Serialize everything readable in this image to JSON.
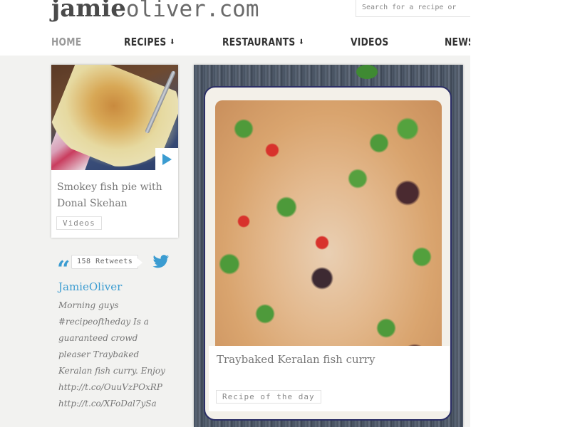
{
  "site": {
    "logo_bold": "jamie",
    "logo_light": "oliver.com"
  },
  "search": {
    "placeholder": "Search for a recipe or"
  },
  "nav": {
    "items": [
      {
        "label": "HOME",
        "has_dropdown": false,
        "active": true
      },
      {
        "label": "RECIPES",
        "has_dropdown": true,
        "active": false
      },
      {
        "label": "RESTAURANTS",
        "has_dropdown": true,
        "active": false
      },
      {
        "label": "VIDEOS",
        "has_dropdown": false,
        "active": false
      },
      {
        "label": "NEWS",
        "has_dropdown": false,
        "active": false
      }
    ],
    "dropdown_glyph": "⬇"
  },
  "video_card": {
    "image_alt": "Smokey fish pie in a blue baking dish",
    "play_icon": "play-icon",
    "title": "Smokey fish pie with Donal Skehan",
    "tag": "Videos"
  },
  "tweet": {
    "quote_glyph": "“",
    "retweets": "158 Retweets",
    "handle": "JamieOliver",
    "text_lines": [
      "Morning guys",
      "#recipeoftheday Is a",
      "guaranteed crowd",
      "pleaser Traybaked",
      "Keralan fish curry. Enjoy",
      "http://t.co/OuuVzPOxRP",
      "http://t.co/XFoDal7ySa"
    ]
  },
  "feature_card": {
    "image_alt": "Traybaked Keralan fish curry in a white enamel tray",
    "title": "Traybaked Keralan fish curry",
    "tag": "Recipe of the day"
  },
  "colors": {
    "accent_blue": "#3b9cd1",
    "nav_active": "#9a9a9a",
    "nav_text": "#333333"
  }
}
